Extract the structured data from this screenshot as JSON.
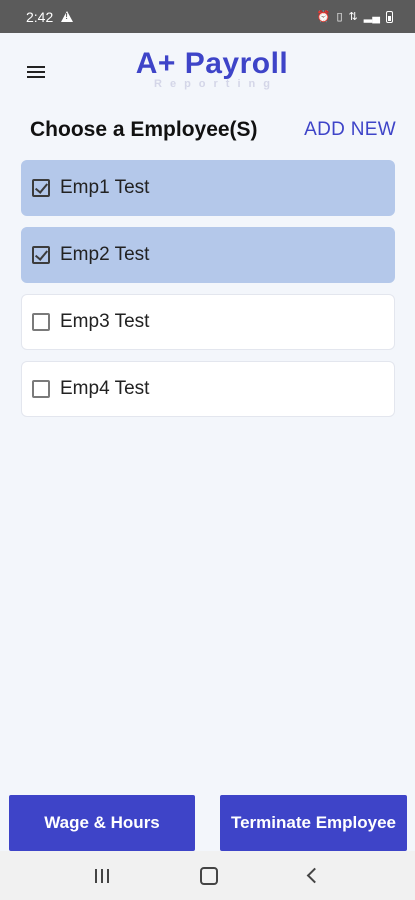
{
  "status_bar": {
    "time": "2:42"
  },
  "header": {
    "logo_main": "A+ Payroll",
    "logo_sub": "Reporting"
  },
  "page": {
    "title": "Choose a Employee(S)",
    "add_new_label": "ADD NEW"
  },
  "employees": [
    {
      "name": "Emp1 Test",
      "checked": true
    },
    {
      "name": "Emp2 Test",
      "checked": true
    },
    {
      "name": "Emp3 Test",
      "checked": false
    },
    {
      "name": "Emp4 Test",
      "checked": false
    }
  ],
  "actions": {
    "wage_hours_label": "Wage & Hours",
    "terminate_label": "Terminate Employee"
  },
  "colors": {
    "accent": "#3e44c8",
    "selected_row": "#b4c8ea",
    "background": "#f3f6fb"
  }
}
